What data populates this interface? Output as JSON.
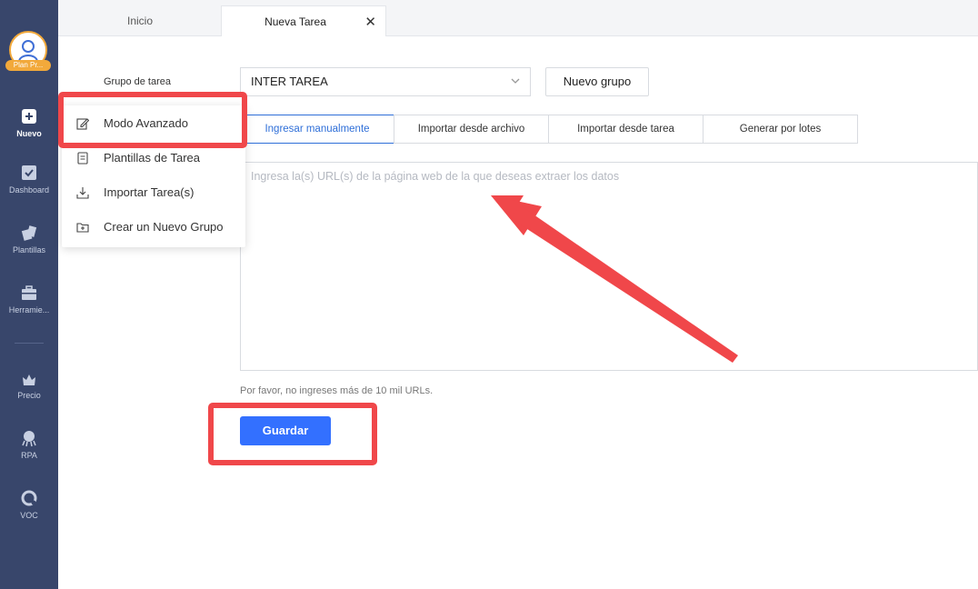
{
  "sidebar": {
    "plan_badge": "Plan Pr...",
    "items": [
      {
        "label": "Nuevo",
        "icon": "plus-square-icon"
      },
      {
        "label": "Dashboard",
        "icon": "dashboard-check-icon"
      },
      {
        "label": "Plantillas",
        "icon": "templates-icon"
      },
      {
        "label": "Herramie...",
        "icon": "toolbox-icon"
      },
      {
        "label": "Precio",
        "icon": "crown-basket-icon"
      },
      {
        "label": "RPA",
        "icon": "octopus-robot-icon"
      },
      {
        "label": "VOC",
        "icon": "voc-circle-icon"
      }
    ]
  },
  "tabs": [
    {
      "label": "Inicio"
    },
    {
      "label": "Nueva Tarea",
      "close": "✕"
    }
  ],
  "form": {
    "group_label": "Grupo de tarea",
    "group_value": "INTER TAREA",
    "new_group_button": "Nuevo grupo",
    "mode_tabs": [
      {
        "label": "Ingresar manualmente"
      },
      {
        "label": "Importar desde archivo"
      },
      {
        "label": "Importar desde tarea"
      },
      {
        "label": "Generar por lotes"
      }
    ],
    "url_placeholder": "Ingresa la(s) URL(s) de la página web de la que deseas extraer los datos",
    "hint": "Por favor, no ingreses más de 10 mil URLs.",
    "save_button": "Guardar"
  },
  "dropdown": {
    "items": [
      {
        "label": "Modo Avanzado",
        "icon": "edit-pencil-icon"
      },
      {
        "label": "Plantillas de Tarea",
        "icon": "document-list-icon"
      },
      {
        "label": "Importar Tarea(s)",
        "icon": "download-tray-icon"
      },
      {
        "label": "Crear un Nuevo Grupo",
        "icon": "folder-plus-icon"
      }
    ]
  },
  "colors": {
    "sidebar_bg": "#38466b",
    "primary": "#3370ff",
    "tab_active": "#2f6fd8",
    "annotation_red": "#f0474a",
    "plan_badge": "#f2a93b"
  }
}
